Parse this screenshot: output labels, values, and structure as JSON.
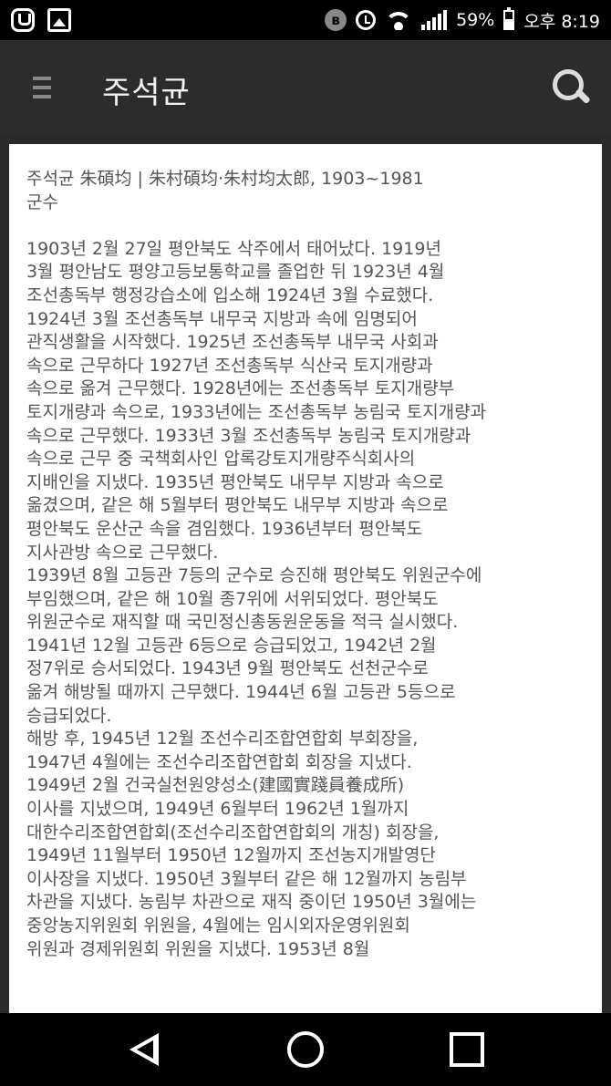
{
  "status_bar": {
    "battery": "59%",
    "time": "오후 8:19",
    "icons": [
      "u-plus-icon",
      "gallery-icon",
      "bluetooth-icon",
      "alarm-icon",
      "wifi-icon",
      "signal-icon",
      "battery-icon"
    ]
  },
  "app_bar": {
    "title": "주석균",
    "menu_icon": "hamburger-menu-icon",
    "search_icon": "search-icon"
  },
  "article": {
    "heading": "주석균 朱碩均 | 朱村碩均·朱村均太郎, 1903~1981\n군수",
    "body": "1903년 2월 27일 평안북도 삭주에서 태어났다. 1919년\n3월 평안남도 평양고등보통학교를 졸업한 뒤 1923년 4월\n조선총독부 행정강습소에 입소해 1924년 3월 수료했다.\n1924년 3월 조선총독부 내무국 지방과 속에 임명되어\n관직생활을 시작했다. 1925년 조선총독부 내무국 사회과\n속으로 근무하다 1927년 조선총독부 식산국 토지개량과\n속으로 옮겨 근무했다. 1928년에는 조선총독부 토지개량부\n토지개량과 속으로, 1933년에는 조선총독부 농림국 토지개량과\n속으로 근무했다. 1933년 3월 조선총독부 농림국 토지개량과\n속으로 근무 중 국책회사인 압록강토지개량주식회사의\n지배인을 지냈다. 1935년 평안북도 내무부 지방과 속으로\n옮겼으며, 같은 해 5월부터 평안북도 내무부 지방과 속으로\n평안북도 운산군 속을 겸임했다. 1936년부터 평안북도\n지사관방 속으로 근무했다.\n1939년 8월 고등관 7등의 군수로 승진해 평안북도 위원군수에\n부임했으며, 같은 해 10월 종7위에 서위되었다. 평안북도\n위원군수로 재직할 때 국민정신총동원운동을 적극 실시했다.\n1941년 12월 고등관 6등으로 승급되었고, 1942년 2월\n정7위로 승서되었다. 1943년 9월 평안북도 선천군수로\n옮겨 해방될 때까지 근무했다. 1944년 6월 고등관 5등으로\n승급되었다.\n해방 후, 1945년 12월 조선수리조합연합회 부회장을,\n1947년 4월에는 조선수리조합연합회 회장을 지냈다.\n1949년 2월 건국실천원양성소(建國實踐員養成所)\n이사를 지냈으며, 1949년 6월부터 1962년 1월까지\n대한수리조합연합회(조선수리조합연합회의 개칭) 회장을,\n1949년 11월부터 1950년 12월까지 조선농지개발영단\n이사장을 지냈다. 1950년 3월부터 같은 해 12월까지 농림부\n차관을 지냈다. 농림부 차관으로 재직 중이던 1950년 3월에는\n중앙농지위원회 위원을, 4월에는 임시외자운영위원회\n위원과 경제위원회 위원을 지냈다. 1953년 8월"
  },
  "nav_bar": {
    "back_icon": "back-triangle-icon",
    "home_icon": "home-circle-icon",
    "recent_icon": "recent-apps-square-icon"
  }
}
